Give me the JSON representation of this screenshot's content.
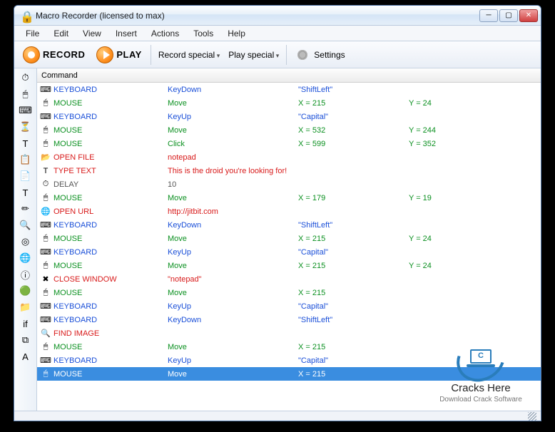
{
  "window": {
    "title": "Macro Recorder (licensed to max)"
  },
  "menu": [
    "File",
    "Edit",
    "View",
    "Insert",
    "Actions",
    "Tools",
    "Help"
  ],
  "toolbar": {
    "record": "RECORD",
    "play": "PLAY",
    "record_special": "Record special",
    "play_special": "Play special",
    "settings": "Settings"
  },
  "grid_header": "Command",
  "rows": [
    {
      "icon": "⌨",
      "cls": "blue",
      "c1": "KEYBOARD",
      "c2": "KeyDown",
      "c3": "\"ShiftLeft\"",
      "c4": ""
    },
    {
      "icon": "🖱",
      "cls": "green",
      "c1": "MOUSE",
      "c2": "Move",
      "c3": "X = 215",
      "c4": "Y = 24"
    },
    {
      "icon": "⌨",
      "cls": "blue",
      "c1": "KEYBOARD",
      "c2": "KeyUp",
      "c3": "\"Capital\"",
      "c4": ""
    },
    {
      "icon": "🖱",
      "cls": "green",
      "c1": "MOUSE",
      "c2": "Move",
      "c3": "X = 532",
      "c4": "Y = 244"
    },
    {
      "icon": "🖱",
      "cls": "green",
      "c1": "MOUSE",
      "c2": "Click",
      "c3": "X = 599",
      "c4": "Y = 352"
    },
    {
      "icon": "📂",
      "cls": "red",
      "c1": "OPEN FILE",
      "c2": "notepad",
      "c3": "",
      "c4": ""
    },
    {
      "icon": "T",
      "cls": "red",
      "c1": "TYPE TEXT",
      "c2": "This is the droid you're looking for!",
      "c3": "",
      "c4": ""
    },
    {
      "icon": "⏱",
      "cls": "gray",
      "c1": "DELAY",
      "c2": "10",
      "c3": "",
      "c4": ""
    },
    {
      "icon": "🖱",
      "cls": "green",
      "c1": "MOUSE",
      "c2": "Move",
      "c3": "X = 179",
      "c4": "Y = 19"
    },
    {
      "icon": "🌐",
      "cls": "red",
      "c1": "OPEN URL",
      "c2": "http://jitbit.com",
      "c3": "",
      "c4": ""
    },
    {
      "icon": "⌨",
      "cls": "blue",
      "c1": "KEYBOARD",
      "c2": "KeyDown",
      "c3": "\"ShiftLeft\"",
      "c4": ""
    },
    {
      "icon": "🖱",
      "cls": "green",
      "c1": "MOUSE",
      "c2": "Move",
      "c3": "X = 215",
      "c4": "Y = 24"
    },
    {
      "icon": "⌨",
      "cls": "blue",
      "c1": "KEYBOARD",
      "c2": "KeyUp",
      "c3": "\"Capital\"",
      "c4": ""
    },
    {
      "icon": "🖱",
      "cls": "green",
      "c1": "MOUSE",
      "c2": "Move",
      "c3": "X = 215",
      "c4": "Y = 24"
    },
    {
      "icon": "✖",
      "cls": "red",
      "c1": "CLOSE WINDOW",
      "c2": "\"notepad\"",
      "c3": "",
      "c4": ""
    },
    {
      "icon": "🖱",
      "cls": "green",
      "c1": "MOUSE",
      "c2": "Move",
      "c3": "X = 215",
      "c4": ""
    },
    {
      "icon": "⌨",
      "cls": "blue",
      "c1": "KEYBOARD",
      "c2": "KeyUp",
      "c3": "\"Capital\"",
      "c4": ""
    },
    {
      "icon": "⌨",
      "cls": "blue",
      "c1": "KEYBOARD",
      "c2": "KeyDown",
      "c3": "\"ShiftLeft\"",
      "c4": ""
    },
    {
      "icon": "🔍",
      "cls": "red",
      "c1": "FIND IMAGE",
      "c2": "",
      "c3": "",
      "c4": ""
    },
    {
      "icon": "🖱",
      "cls": "green",
      "c1": "MOUSE",
      "c2": "Move",
      "c3": "X = 215",
      "c4": ""
    },
    {
      "icon": "⌨",
      "cls": "blue",
      "c1": "KEYBOARD",
      "c2": "KeyUp",
      "c3": "\"Capital\"",
      "c4": ""
    },
    {
      "icon": "🖱",
      "cls": "green",
      "c1": "MOUSE",
      "c2": "Move",
      "c3": "X = 215",
      "c4": "",
      "sel": true
    }
  ],
  "overlay": {
    "line1": "Cracks Here",
    "line2": "Download Crack Software"
  },
  "sidetools": [
    "⏱",
    "🖱",
    "⌨",
    "⏳",
    "T",
    "📋",
    "📄",
    "T",
    "✏",
    "🔍",
    "◎",
    "🌐",
    "ⓘ",
    "🟢",
    "📁",
    "if",
    "⧉",
    "A"
  ]
}
